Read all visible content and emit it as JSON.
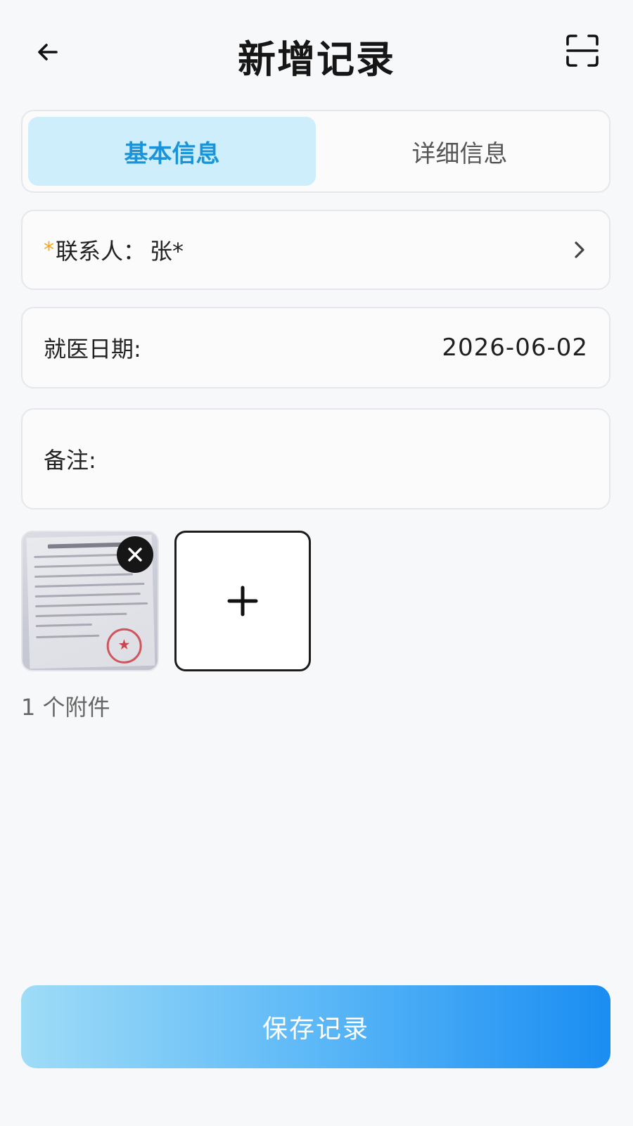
{
  "header": {
    "title": "新增记录",
    "back_icon": "arrow-left-icon",
    "scan_icon": "scan-icon"
  },
  "tabs": [
    {
      "label": "基本信息",
      "active": true
    },
    {
      "label": "详细信息",
      "active": false
    }
  ],
  "form": {
    "contact": {
      "required_mark": "*",
      "label": "联系人：",
      "value": "张*"
    },
    "visit_date": {
      "label": "就医日期:",
      "value": "2026-06-02"
    },
    "note": {
      "label": "备注:",
      "value": ""
    }
  },
  "attachments": {
    "count_text": "1 个附件"
  },
  "save_button": {
    "label": "保存记录"
  },
  "colors": {
    "accent": "#1a93d9",
    "tab_active_bg": "#cfeefc",
    "required": "#f5a623",
    "button_start": "#9fdcf7",
    "button_end": "#1a8df2"
  }
}
